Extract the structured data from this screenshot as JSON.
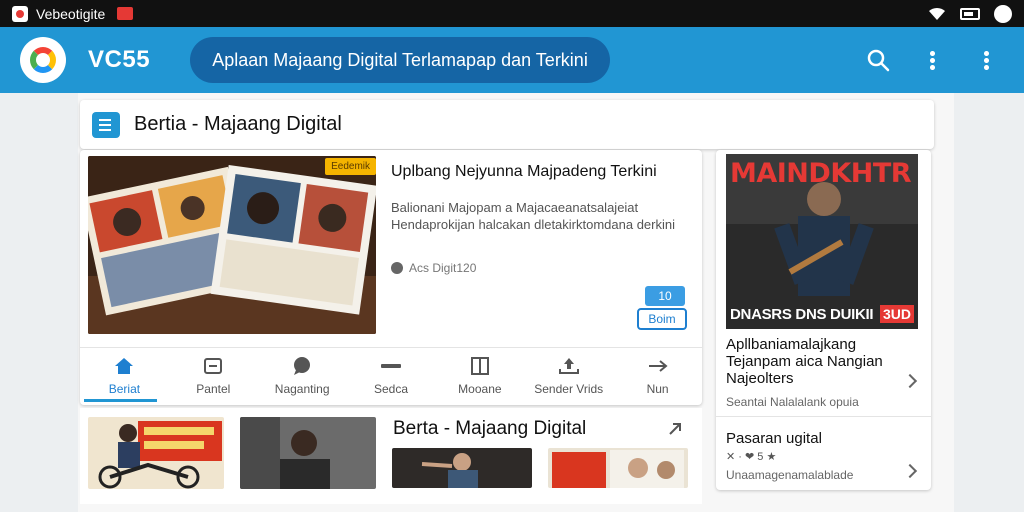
{
  "status_bar": {
    "app_name": "Vebeotigite"
  },
  "app_bar": {
    "brand": "VC55",
    "search_text": "Aplaan Majaang Digital Terlamapap dan Terkini"
  },
  "section": {
    "title": "Bertia - Majaang Digital"
  },
  "featured": {
    "badge": "Eedemik",
    "title": "Uplbang Nejyunna Majpadeng Terkini",
    "description": "Balionani Majopam a Majacaeanatsalajeiat Hendaprokijan halcakan dletakirktomdana derkini",
    "meta": "Acs Digit120",
    "count": "10",
    "button_label": "Boim"
  },
  "tabs": [
    {
      "label": "Beriat",
      "icon": "home-icon",
      "active": true
    },
    {
      "label": "Pantel",
      "icon": "inbox-icon",
      "active": false
    },
    {
      "label": "Naganting",
      "icon": "chat-icon",
      "active": false
    },
    {
      "label": "Sedca",
      "icon": "minus-icon",
      "active": false
    },
    {
      "label": "Mooane",
      "icon": "book-icon",
      "active": false
    },
    {
      "label": "Sender Vrids",
      "icon": "upload-icon",
      "active": false
    },
    {
      "label": "Nun",
      "icon": "arrow-right-icon",
      "active": false
    }
  ],
  "more": {
    "title": "Berta - Majaang Digital"
  },
  "sidebar": {
    "magazine_title": "MAINDKHTR",
    "magazine_footer": "DNASRS DNS DUIKII",
    "magazine_footer_badge": "3UD",
    "item1_title": "Apllbaniamalajkang Tejanpam aica Nangian Najeolters",
    "item1_sub": "Seantai Nalalalank opuia",
    "item2_title": "Pasaran ugital",
    "item2_sub": "✕ · ❤ 5 ★",
    "item2_detail": "Unaamagenamalablade"
  },
  "colors": {
    "accent": "#2196d3",
    "accent_dark": "#1565a5",
    "status_bar": "#111111"
  }
}
